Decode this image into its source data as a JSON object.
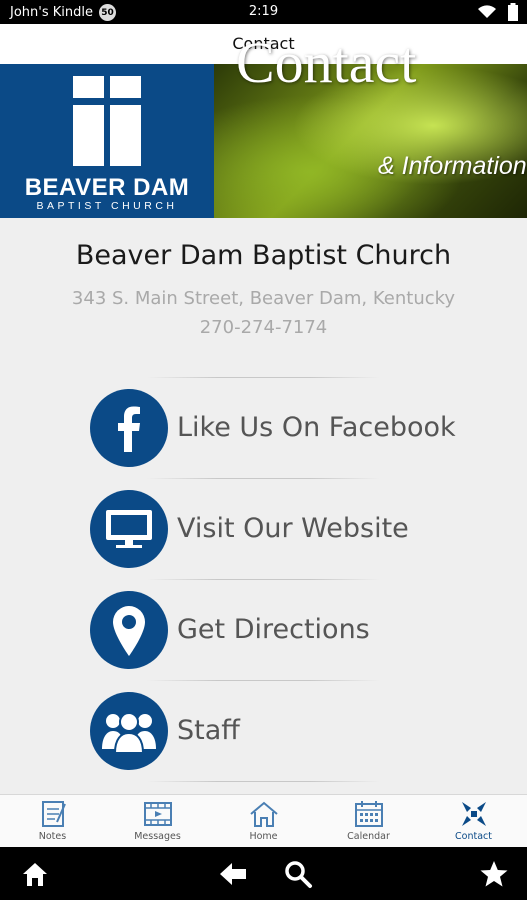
{
  "status_bar": {
    "device_name": "John's Kindle",
    "notification_count": "50",
    "time": "2:19"
  },
  "header": {
    "title": "Contact"
  },
  "banner": {
    "logo_name": "BEAVER DAM",
    "logo_sub": "BAPTIST CHURCH",
    "title": "Contact",
    "subtitle": "& Information"
  },
  "info": {
    "name": "Beaver Dam Baptist Church",
    "address": "343 S. Main Street, Beaver Dam, Kentucky",
    "phone": "270-274-7174"
  },
  "links": [
    {
      "label": "Like Us On Facebook",
      "icon": "facebook-icon"
    },
    {
      "label": "Visit Our Website",
      "icon": "monitor-icon"
    },
    {
      "label": "Get Directions",
      "icon": "map-pin-icon"
    },
    {
      "label": "Staff",
      "icon": "people-icon"
    }
  ],
  "tabs": [
    {
      "label": "Notes",
      "icon": "notes-icon"
    },
    {
      "label": "Messages",
      "icon": "film-icon"
    },
    {
      "label": "Home",
      "icon": "home-icon"
    },
    {
      "label": "Calendar",
      "icon": "calendar-icon"
    },
    {
      "label": "Contact",
      "icon": "contact-icon",
      "active": true
    }
  ],
  "colors": {
    "brand": "#0b4a87",
    "tab_icon": "#4a7fb3"
  }
}
